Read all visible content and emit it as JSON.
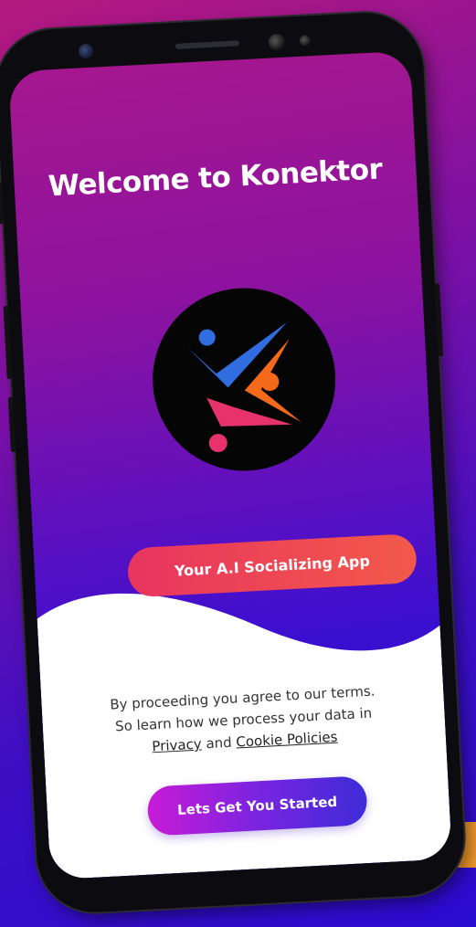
{
  "screen": {
    "title": "Welcome to Konektor",
    "tagline_button": "Your A.I Socializing App",
    "terms": {
      "line1": "By proceeding you agree to our terms.",
      "line2": "So learn how we process your data in",
      "privacy_link": "Privacy",
      "and_text": "and",
      "cookie_link": "Cookie Policies"
    },
    "start_button": "Lets Get You Started"
  },
  "colors": {
    "accent_pink": "#e8355f",
    "accent_purple": "#7a24e0",
    "logo_blue": "#2f6de0",
    "logo_orange": "#f56a1a",
    "logo_pink": "#e8326e"
  },
  "icons": {
    "logo": "konektor-logo-icon"
  }
}
